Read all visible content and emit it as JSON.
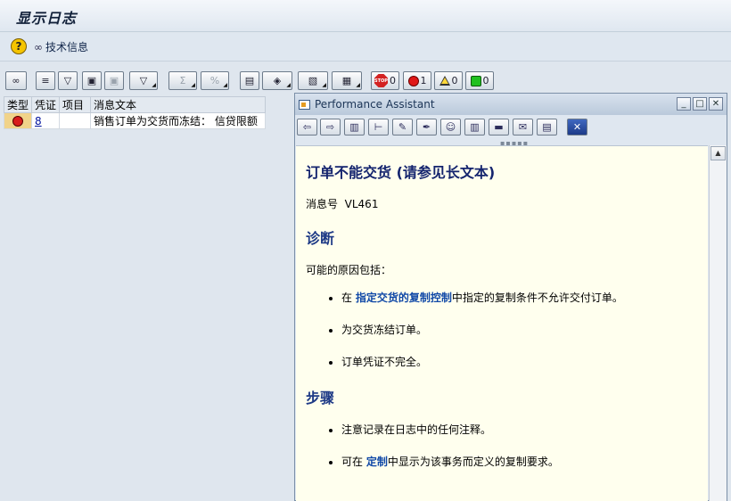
{
  "window": {
    "title": "显示日志"
  },
  "app_toolbar": {
    "help_label": "?",
    "tech_info_label": "技术信息"
  },
  "counters": {
    "stop": "0",
    "error": "1",
    "warning": "0",
    "success": "0",
    "stop_label": "STOP"
  },
  "table": {
    "headers": [
      "类型",
      "凭证",
      "项目",
      "消息文本"
    ],
    "rows": [
      {
        "type_icon": "error-icon",
        "document": "8",
        "item": "",
        "text": "销售订单为交货而冻结： 信贷限额"
      }
    ]
  },
  "performance_assistant": {
    "title": "Performance Assistant",
    "heading": "订单不能交货 (请参见长文本)",
    "message_no_label": "消息号",
    "message_no": "VL461",
    "diagnosis_heading": "诊断",
    "diagnosis_intro": "可能的原因包括：",
    "diagnosis_items": [
      {
        "prefix": "在 ",
        "link": "指定交货的复制控制",
        "suffix": "中指定的复制条件不允许交付订单。"
      },
      {
        "prefix": "为交货冻结订单。",
        "link": "",
        "suffix": ""
      },
      {
        "prefix": "订单凭证不完全。",
        "link": "",
        "suffix": ""
      }
    ],
    "procedure_heading": "步骤",
    "procedure_items": [
      {
        "prefix": "注意记录在日志中的任何注释。",
        "link": "",
        "suffix": ""
      },
      {
        "prefix": "可在 ",
        "link": "定制",
        "suffix": "中显示为该事务而定义的复制要求。"
      }
    ]
  }
}
